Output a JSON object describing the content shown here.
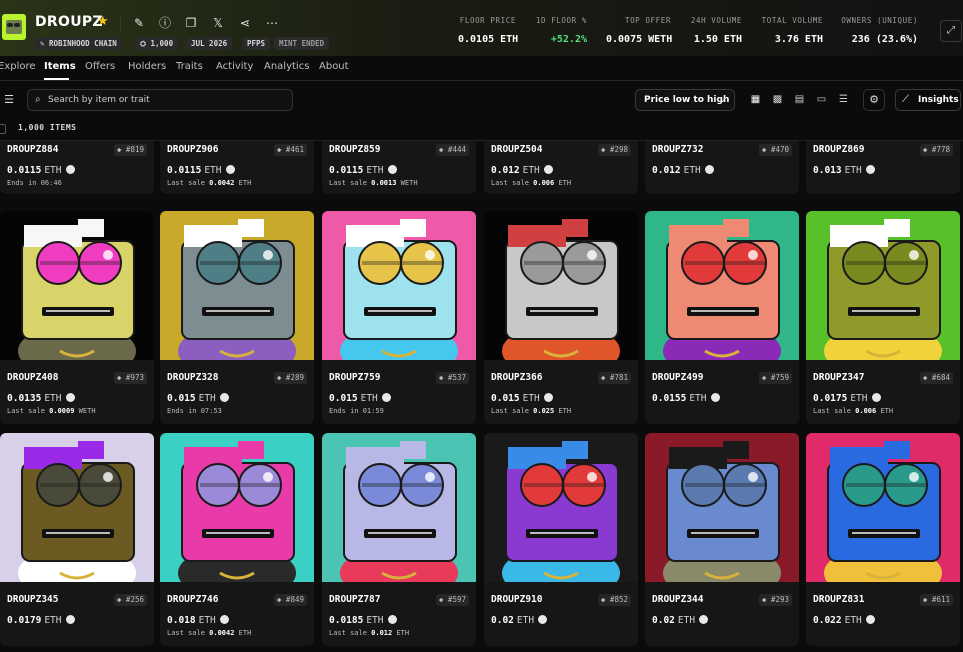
{
  "collection": {
    "title": "DROUPZ",
    "chips": [
      "ROBINHOOD CHAIN",
      "1,000",
      "JUL 2026",
      "PFPS",
      "MINT ENDED"
    ],
    "stats": [
      {
        "label": "FLOOR PRICE",
        "value": "0.0105 ETH"
      },
      {
        "label": "1D FLOOR %",
        "value": "+52.2%"
      },
      {
        "label": "TOP OFFER",
        "value": "0.0075 WETH"
      },
      {
        "label": "24H VOLUME",
        "value": "1.50 ETH"
      },
      {
        "label": "TOTAL VOLUME",
        "value": "3.76 ETH"
      },
      {
        "label": "OWNERS (UNIQUE)",
        "value": "236 (23.6%)"
      }
    ]
  },
  "tabs": [
    "Explore",
    "Items",
    "Offers",
    "Holders",
    "Traits",
    "Activity",
    "Analytics",
    "About"
  ],
  "toolbar": {
    "search_placeholder": "Search by item or trait",
    "sort_label": "Price low to high",
    "insights_label": "Insights",
    "item_count": "1,000 ITEMS"
  },
  "colors": {
    "accent_green": "#54e07a",
    "star": "#f5c518",
    "brand": "#b9f32b"
  },
  "top_row": [
    {
      "name": "DROUPZ884",
      "num": "#819",
      "price": "0.0115",
      "unit": "ETH",
      "sub_pre": "Ends in 06:46",
      "sub_val": "",
      "sub_unit": ""
    },
    {
      "name": "DROUPZ906",
      "num": "#461",
      "price": "0.0115",
      "unit": "ETH",
      "sub_pre": "Last sale",
      "sub_val": "0.0042",
      "sub_unit": "ETH"
    },
    {
      "name": "DROUPZ859",
      "num": "#444",
      "price": "0.0115",
      "unit": "ETH",
      "sub_pre": "Last sale",
      "sub_val": "0.0013",
      "sub_unit": "WETH"
    },
    {
      "name": "DROUPZ504",
      "num": "#298",
      "price": "0.012",
      "unit": "ETH",
      "sub_pre": "Last sale",
      "sub_val": "0.006",
      "sub_unit": "ETH"
    },
    {
      "name": "DROUPZ732",
      "num": "#470",
      "price": "0.012",
      "unit": "ETH",
      "sub_pre": "",
      "sub_val": "",
      "sub_unit": ""
    },
    {
      "name": "DROUPZ869",
      "num": "#778",
      "price": "0.013",
      "unit": "ETH",
      "sub_pre": "",
      "sub_val": "",
      "sub_unit": ""
    }
  ],
  "mid_row": [
    {
      "name": "DROUPZ408",
      "num": "#973",
      "price": "0.0135",
      "unit": "ETH",
      "sub_pre": "Last sale",
      "sub_val": "0.0009",
      "sub_unit": "WETH",
      "bg": "#050505",
      "skin": "#d9d46a",
      "glasses": "#f03cc0",
      "hair": "#f7f7f7",
      "shirt": "#6a6a4a"
    },
    {
      "name": "DROUPZ328",
      "num": "#289",
      "price": "0.015",
      "unit": "ETH",
      "sub_pre": "Ends in 07:53",
      "sub_val": "",
      "sub_unit": "",
      "bg": "#c9a92a",
      "skin": "#7d8d92",
      "glasses": "#4f7f86",
      "hair": "#ffffff",
      "shirt": "#8a5fc0"
    },
    {
      "name": "DROUPZ759",
      "num": "#537",
      "price": "0.015",
      "unit": "ETH",
      "sub_pre": "Ends in 01:59",
      "sub_val": "",
      "sub_unit": "",
      "bg": "#ef5aa8",
      "skin": "#9ee2ee",
      "glasses": "#e6c44a",
      "hair": "#ffffff",
      "shirt": "#46c7ee"
    },
    {
      "name": "DROUPZ366",
      "num": "#781",
      "price": "0.015",
      "unit": "ETH",
      "sub_pre": "Last sale",
      "sub_val": "0.025",
      "sub_unit": "ETH",
      "bg": "#050505",
      "skin": "#c8c8c8",
      "glasses": "#9a9a9a",
      "hair": "#d04040",
      "shirt": "#e0552a"
    },
    {
      "name": "DROUPZ499",
      "num": "#759",
      "price": "0.0155",
      "unit": "ETH",
      "sub_pre": "",
      "sub_val": "",
      "sub_unit": "",
      "bg": "#2fb78a",
      "skin": "#ee8a74",
      "glasses": "#e23a3a",
      "hair": "#ee8a74",
      "shirt": "#8a2ab7"
    },
    {
      "name": "DROUPZ347",
      "num": "#684",
      "price": "0.0175",
      "unit": "ETH",
      "sub_pre": "Last sale",
      "sub_val": "0.006",
      "sub_unit": "ETH",
      "bg": "#58c12a",
      "skin": "#8f9a2a",
      "glasses": "#7a8a20",
      "hair": "#ffffff",
      "shirt": "#f0d23a"
    }
  ],
  "bot_row": [
    {
      "name": "DROUPZ345",
      "num": "#256",
      "price": "0.0179",
      "unit": "ETH",
      "sub_pre": "",
      "sub_val": "",
      "sub_unit": "",
      "bg": "#d8d0e8",
      "skin": "#6b5a22",
      "glasses": "#4a4a3a",
      "hair": "#9a2ae8",
      "shirt": "#ffffff"
    },
    {
      "name": "DROUPZ746",
      "num": "#849",
      "price": "0.018",
      "unit": "ETH",
      "sub_pre": "Last sale",
      "sub_val": "0.0042",
      "sub_unit": "ETH",
      "bg": "#3ad0c4",
      "skin": "#e83aa8",
      "glasses": "#9a8ad8",
      "hair": "#e83aa8",
      "shirt": "#2a2a2a"
    },
    {
      "name": "DROUPZ787",
      "num": "#597",
      "price": "0.0185",
      "unit": "ETH",
      "sub_pre": "Last sale",
      "sub_val": "0.012",
      "sub_unit": "ETH",
      "bg": "#4cc4b4",
      "skin": "#b8b8e6",
      "glasses": "#7a8ad8",
      "hair": "#b8b8e6",
      "shirt": "#e83a5a"
    },
    {
      "name": "DROUPZ910",
      "num": "#852",
      "price": "0.02",
      "unit": "ETH",
      "sub_pre": "",
      "sub_val": "",
      "sub_unit": "",
      "bg": "#1a1a1a",
      "skin": "#8a3ad0",
      "glasses": "#e23a3a",
      "hair": "#3a8ae8",
      "shirt": "#3ab8e8"
    },
    {
      "name": "DROUPZ344",
      "num": "#293",
      "price": "0.02",
      "unit": "ETH",
      "sub_pre": "",
      "sub_val": "",
      "sub_unit": "",
      "bg": "#8a1a2a",
      "skin": "#6a8ad0",
      "glasses": "#5a7ab0",
      "hair": "#1a1a1a",
      "shirt": "#8a8a6a"
    },
    {
      "name": "DROUPZ831",
      "num": "#611",
      "price": "0.022",
      "unit": "ETH",
      "sub_pre": "",
      "sub_val": "",
      "sub_unit": "",
      "bg": "#e02a6a",
      "skin": "#2a6ae0",
      "glasses": "#2a9a8a",
      "hair": "#2a6ae0",
      "shirt": "#f0c03a"
    }
  ]
}
